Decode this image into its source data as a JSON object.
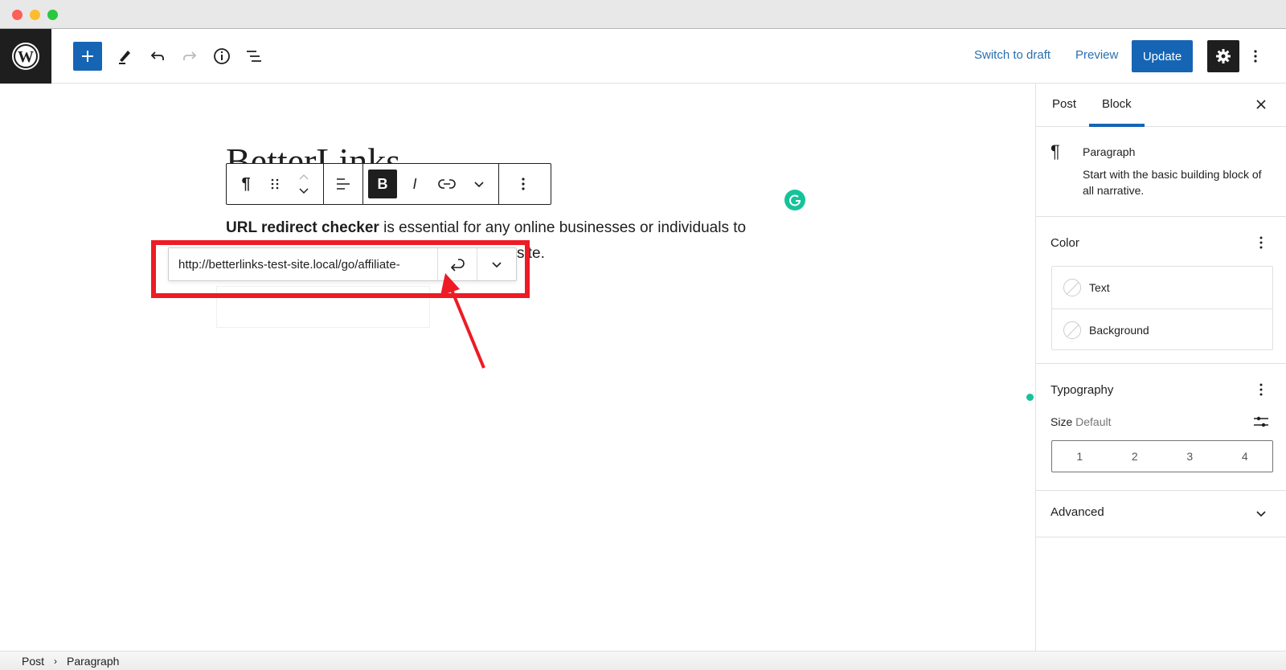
{
  "window": {
    "controls": [
      "close",
      "minimize",
      "zoom"
    ]
  },
  "topbar": {
    "logo": "wordpress-logo",
    "tools": [
      {
        "name": "add-block",
        "icon": "plus-icon"
      },
      {
        "name": "tools",
        "icon": "pencil-icon"
      },
      {
        "name": "undo",
        "icon": "undo-icon"
      },
      {
        "name": "redo",
        "icon": "redo-icon",
        "disabled": true
      },
      {
        "name": "details",
        "icon": "info-icon"
      },
      {
        "name": "list-view",
        "icon": "list-view-icon"
      }
    ],
    "switch_to_draft": "Switch to draft",
    "preview": "Preview",
    "update": "Update"
  },
  "editor": {
    "post_title": "BetterLinks",
    "block_toolbar": {
      "bold": "B",
      "italic": "I"
    },
    "paragraph": {
      "bold_text": "URL redirect checker",
      "line1_rest": " is essential for any online businesses or individuals to",
      "line2_visible_end": "site."
    },
    "link_popover": {
      "url_value": "http://betterlinks-test-site.local/go/affiliate-"
    }
  },
  "sidebar": {
    "tabs": [
      {
        "label": "Post",
        "active": false
      },
      {
        "label": "Block",
        "active": true
      }
    ],
    "block": {
      "name": "Paragraph",
      "description": "Start with the basic building block of all narrative."
    },
    "color": {
      "title": "Color",
      "items": [
        "Text",
        "Background"
      ]
    },
    "typography": {
      "title": "Typography",
      "size_label": "Size",
      "size_value": "Default",
      "sizes": [
        "1",
        "2",
        "3",
        "4"
      ]
    },
    "advanced": {
      "title": "Advanced"
    }
  },
  "breadcrumb": [
    "Post",
    "Paragraph"
  ],
  "colors": {
    "accent": "#1565b4",
    "dark": "#1e1e1e",
    "annotation": "#ee1b24",
    "grammarly": "#15c39a"
  }
}
